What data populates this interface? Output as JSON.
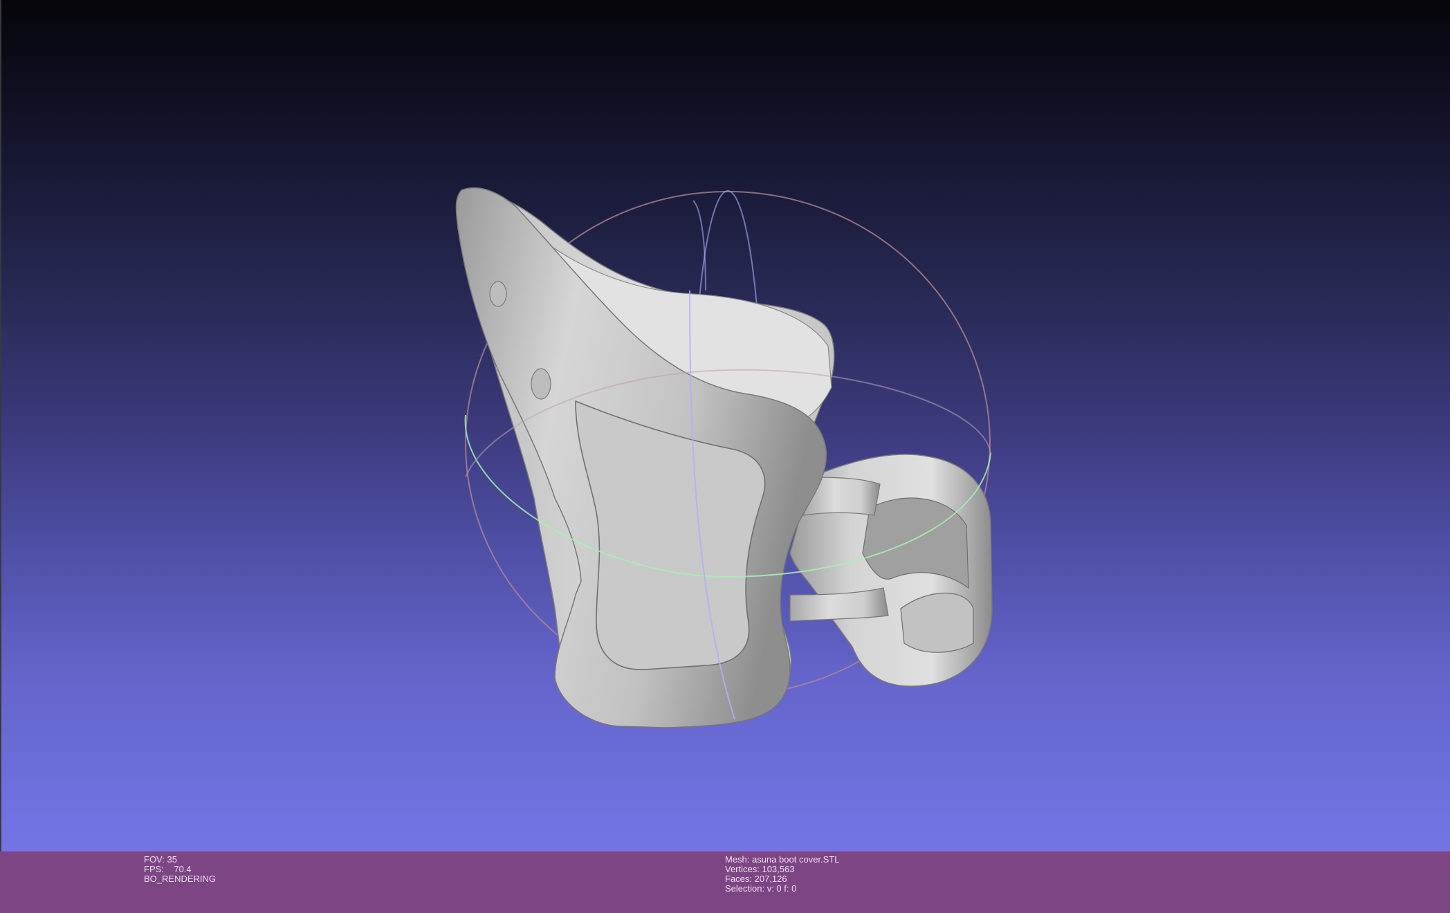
{
  "viewport": {
    "background_top": "#05050a",
    "background_bottom": "#7474e6",
    "model_color": "#c8c8c8",
    "trackball_colors": {
      "x_ring": "#d9a3a8",
      "y_ring": "#a8a8f0",
      "z_ring": "#a8f0b0"
    }
  },
  "status": {
    "left": {
      "fov": "FOV: 35",
      "fps": "FPS:    70.4",
      "mode": "BO_RENDERING"
    },
    "mesh": {
      "name": "Mesh: asuna boot cover.STL",
      "vertices": "Vertices: 103,563",
      "faces": "Faces: 207,126",
      "selection": "Selection: v: 0 f: 0"
    },
    "background": "#7e4585"
  }
}
